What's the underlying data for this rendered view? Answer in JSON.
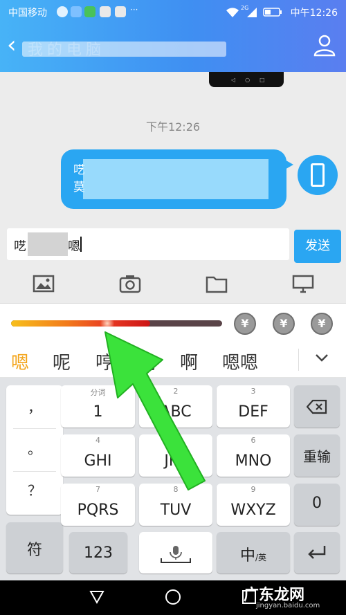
{
  "status_bar": {
    "carrier": "中国移动",
    "time": "中午12:26",
    "network": "2G"
  },
  "header": {
    "title": "我的电脑"
  },
  "chat": {
    "timestamp": "下午12:26",
    "message_first_chars": [
      "呓",
      "莫"
    ]
  },
  "composer": {
    "input_prefix": "呓",
    "input_suffix": "嗯",
    "send_label": "发送"
  },
  "toolbar": {
    "icons": [
      "image-icon",
      "camera-icon",
      "folder-icon",
      "computer-icon"
    ]
  },
  "keyboard": {
    "progress": 0.66,
    "coin_symbol": "¥",
    "candidates": [
      "嗯",
      "呢",
      "哼",
      "呐",
      "啊",
      "嗯嗯"
    ],
    "punctuation": [
      "，",
      "。",
      "？"
    ],
    "symbols_label": "符",
    "keys": [
      {
        "sub": "分词",
        "main": "1"
      },
      {
        "sub": "2",
        "main": "ABC"
      },
      {
        "sub": "3",
        "main": "DEF"
      },
      {
        "sub": "4",
        "main": "GHI"
      },
      {
        "sub": "5",
        "main": "JKL"
      },
      {
        "sub": "6",
        "main": "MNO"
      },
      {
        "sub": "7",
        "main": "PQRS"
      },
      {
        "sub": "8",
        "main": "TUV"
      },
      {
        "sub": "9",
        "main": "WXYZ"
      }
    ],
    "retype_label": "重输",
    "zero_label": "0",
    "num_label": "123",
    "lang_main": "中",
    "lang_sub": "/英"
  },
  "colors": {
    "accent": "#2aa6f2",
    "candidate_highlight": "#f3a317",
    "arrow": "#3be23b"
  },
  "watermark": {
    "main": "广东龙网",
    "sub": "jingyan.baidu.com"
  }
}
